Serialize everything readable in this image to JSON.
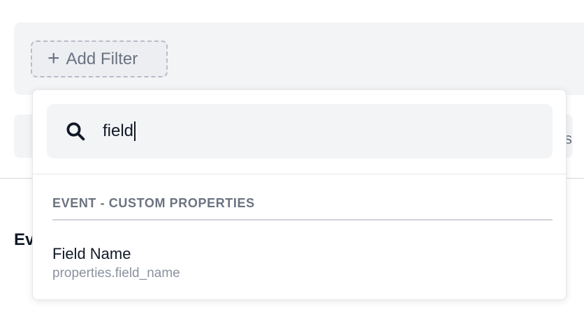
{
  "filter_bar": {
    "add_filter_plus": "+",
    "add_filter_label": "Add Filter"
  },
  "background": {
    "second_row_tail": "s",
    "heading_fragment": "Ev"
  },
  "dropdown": {
    "search": {
      "value": "field",
      "icon": "search-icon"
    },
    "sections": [
      {
        "header": "EVENT - CUSTOM PROPERTIES",
        "items": [
          {
            "label": "Field Name",
            "path": "properties.field_name"
          }
        ]
      }
    ]
  },
  "colors": {
    "panel_bg": "#f3f4f6",
    "muted_text": "#6b7280",
    "path_text": "#8b92a0"
  }
}
